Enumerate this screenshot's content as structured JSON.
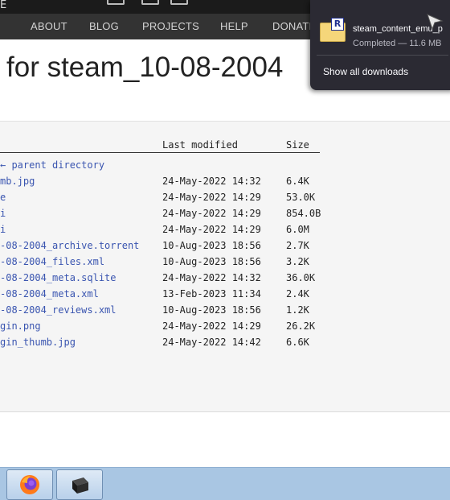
{
  "topbar": {
    "glyph": "E"
  },
  "nav": {
    "items": [
      "ABOUT",
      "BLOG",
      "PROJECTS",
      "HELP",
      "DONATE"
    ]
  },
  "page": {
    "title": "for steam_10-08-2004"
  },
  "listing": {
    "headers": {
      "last_modified": "Last modified",
      "size": "Size"
    },
    "rows": [
      {
        "name": "← parent directory",
        "date": "",
        "size": ""
      },
      {
        "name": "mb.jpg",
        "date": "24-May-2022 14:32",
        "size": "6.4K"
      },
      {
        "name": "e",
        "date": "24-May-2022 14:29",
        "size": "53.0K"
      },
      {
        "name": "i",
        "date": "24-May-2022 14:29",
        "size": "854.0B"
      },
      {
        "name": "i",
        "date": "24-May-2022 14:29",
        "size": "6.0M"
      },
      {
        "name": "-08-2004_archive.torrent",
        "date": "10-Aug-2023 18:56",
        "size": "2.7K"
      },
      {
        "name": "-08-2004_files.xml",
        "date": "10-Aug-2023 18:56",
        "size": "3.2K"
      },
      {
        "name": "-08-2004_meta.sqlite",
        "date": "24-May-2022 14:32",
        "size": "36.0K"
      },
      {
        "name": "-08-2004_meta.xml",
        "date": "13-Feb-2023 11:34",
        "size": "2.4K"
      },
      {
        "name": "-08-2004_reviews.xml",
        "date": "10-Aug-2023 18:56",
        "size": "1.2K"
      },
      {
        "name": "gin.png",
        "date": "24-May-2022 14:29",
        "size": "26.2K"
      },
      {
        "name": "gin_thumb.jpg",
        "date": "24-May-2022 14:42",
        "size": "6.6K"
      }
    ]
  },
  "downloads": {
    "file_name": "steam_content_emu_p",
    "status": "Completed — 11.6 MB",
    "badge": "R",
    "show_all": "Show all downloads"
  },
  "taskbar": {
    "apps": [
      "firefox-icon",
      "terminal-icon"
    ]
  }
}
